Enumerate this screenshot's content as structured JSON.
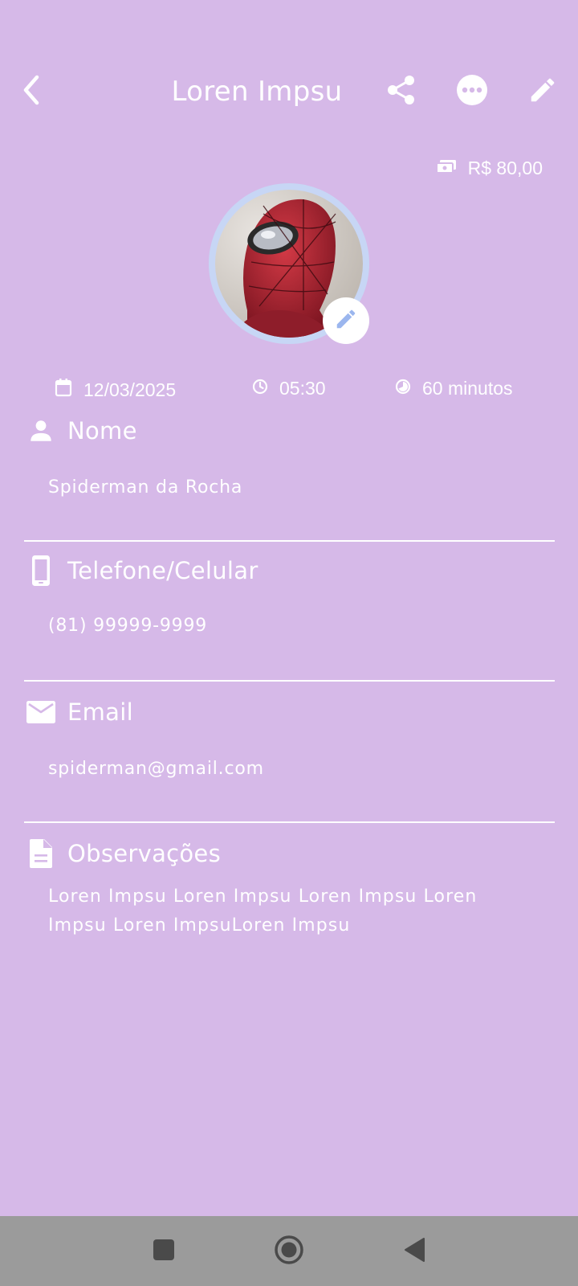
{
  "header": {
    "title": "Loren Impsu",
    "back_icon": "chevron-left-icon",
    "share_icon": "share-icon",
    "more_icon": "more-horizontal-icon",
    "edit_icon": "pencil-icon"
  },
  "price": {
    "value": "R$ 80,00",
    "icon": "payments-icon"
  },
  "avatar": {
    "edit_icon": "pencil-icon",
    "ring_color": "#c7d6f5"
  },
  "meta": {
    "date": "12/03/2025",
    "time": "05:30",
    "duration": "60 minutos"
  },
  "sections": {
    "name": {
      "title": "Nome",
      "value": "Spiderman da Rocha",
      "icon": "person-icon"
    },
    "phone": {
      "title": "Telefone/Celular",
      "value": "(81) 99999-9999",
      "icon": "smartphone-icon"
    },
    "email": {
      "title": "Email",
      "value": "spiderman@gmail.com",
      "icon": "mail-icon"
    },
    "notes": {
      "title": "Observações",
      "value": "Loren Impsu Loren Impsu Loren Impsu Loren Impsu Loren ImpsuLoren Impsu",
      "icon": "document-icon"
    }
  },
  "navbar": {
    "recents_icon": "square-icon",
    "home_icon": "circle-icon",
    "back_icon": "triangle-back-icon"
  },
  "colors": {
    "background": "#d6b9e8",
    "text": "#ffffff",
    "navbar": "#9b9b9b",
    "accent": "#c7d6f5"
  }
}
